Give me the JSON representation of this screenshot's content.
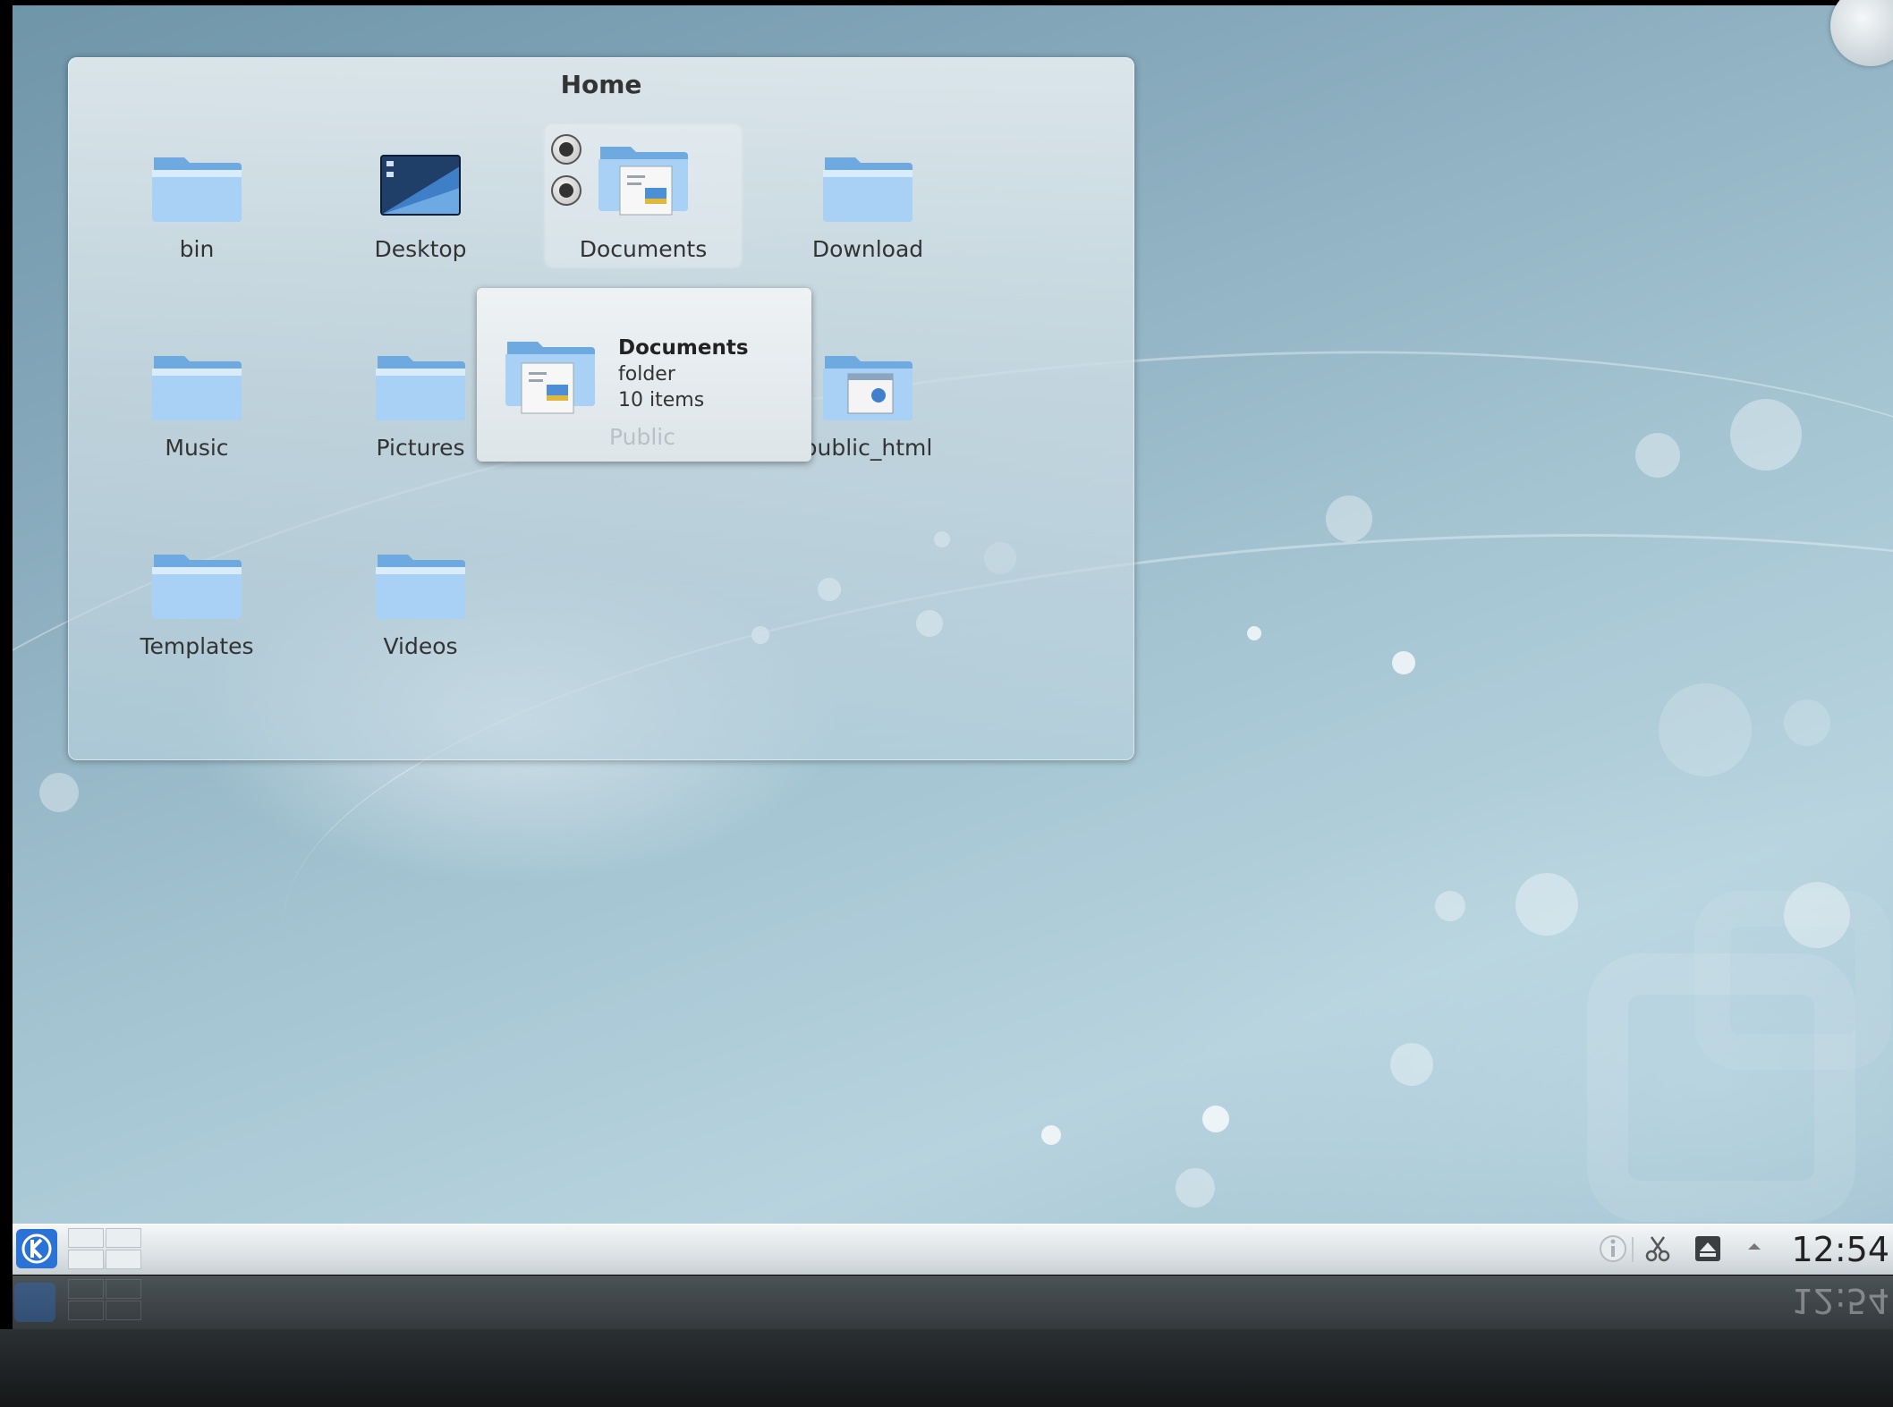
{
  "folderview": {
    "title": "Home",
    "items": [
      {
        "label": "bin",
        "icon": "folder-icon"
      },
      {
        "label": "Desktop",
        "icon": "desktop-folder-icon"
      },
      {
        "label": "Documents",
        "icon": "documents-folder-icon"
      },
      {
        "label": "Download",
        "icon": "folder-icon"
      },
      {
        "label": "Music",
        "icon": "folder-icon"
      },
      {
        "label": "Pictures",
        "icon": "folder-icon"
      },
      {
        "label": "Public",
        "icon": "folder-icon"
      },
      {
        "label": "public_html",
        "icon": "html-folder-icon"
      },
      {
        "label": "Templates",
        "icon": "folder-icon"
      },
      {
        "label": "Videos",
        "icon": "folder-icon"
      }
    ]
  },
  "tooltip": {
    "title": "Documents",
    "type": "folder",
    "count": "10 items"
  },
  "panel": {
    "clock": "12:54",
    "tray_icons": [
      "info-icon",
      "scissors-icon",
      "network-icon",
      "expand-arrow-icon"
    ]
  },
  "colors": {
    "wallpaper": "#9fbfcf",
    "panel": "#dfe4e7",
    "folder_blue": "#7fb6ea",
    "kde_blue": "#2b72d6"
  }
}
